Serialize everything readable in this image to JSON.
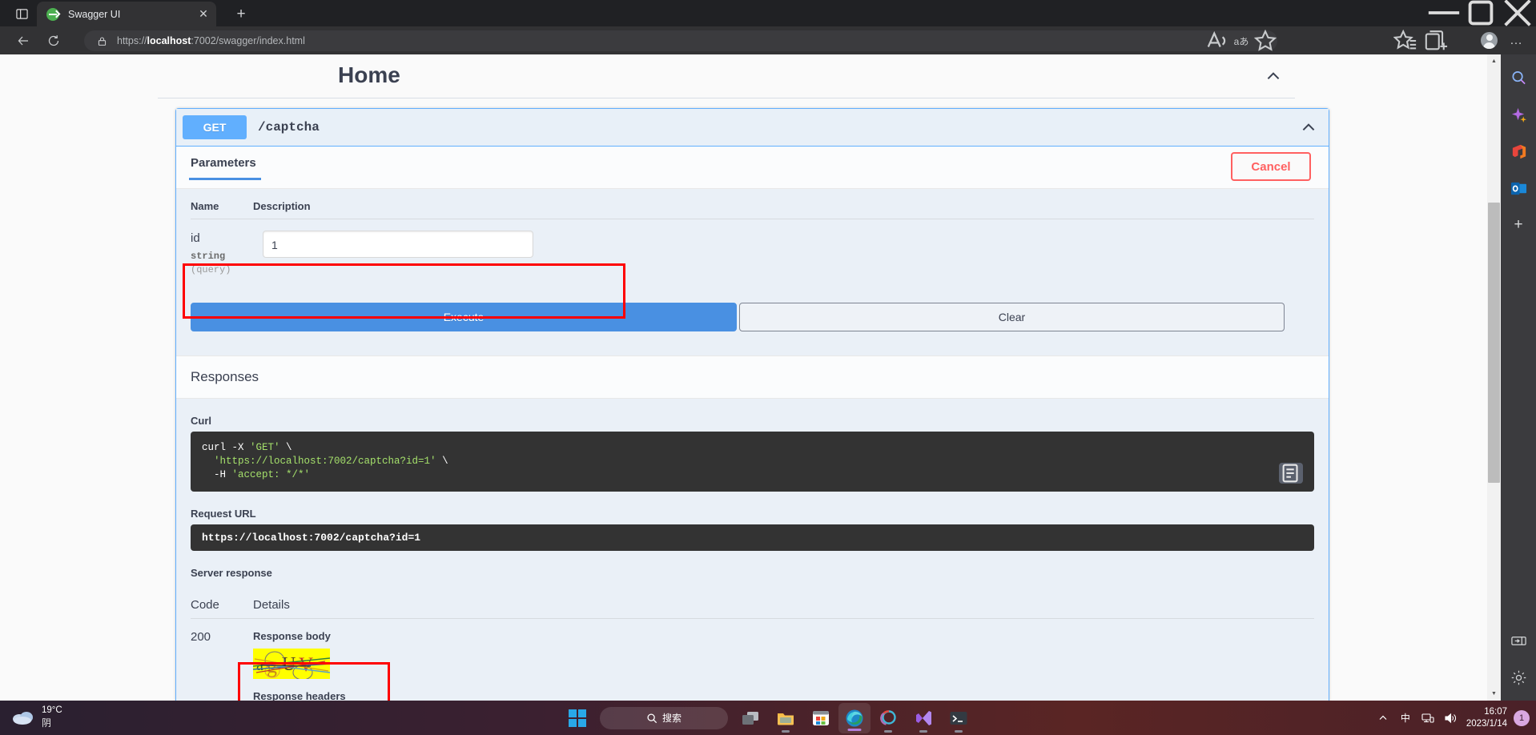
{
  "browser": {
    "tab_title": "Swagger UI",
    "tab_close": "✕",
    "new_tab": "+",
    "url_prefix": "https://",
    "url_host": "localhost",
    "url_rest": ":7002/swagger/index.html",
    "window_minimize": "—",
    "window_maximize": "❐",
    "window_close": "✕",
    "omni_more": "…",
    "read_aloud": "A",
    "translate": "aあ",
    "favorite": "☆"
  },
  "sidebar": {
    "items": [
      {
        "name": "search-icon"
      },
      {
        "name": "copilot-icon"
      },
      {
        "name": "office-icon"
      },
      {
        "name": "outlook-icon"
      },
      {
        "name": "add-icon",
        "label": "+"
      }
    ],
    "bottom": [
      {
        "name": "sidebar-toggle-icon"
      },
      {
        "name": "settings-gear-icon"
      }
    ]
  },
  "swagger": {
    "page_title": "Home",
    "operation": {
      "verb": "GET",
      "path": "/captcha"
    },
    "tab_parameters": "Parameters",
    "cancel_label": "Cancel",
    "param_headers": {
      "name": "Name",
      "description": "Description"
    },
    "parameter": {
      "name": "id",
      "type": "string",
      "location": "(query)",
      "value": "1",
      "placeholder": "id"
    },
    "execute_label": "Execute",
    "clear_label": "Clear",
    "responses_title": "Responses",
    "curl_label": "Curl",
    "curl_line1_cmd": "curl -X ",
    "curl_line1_val": "'GET'",
    "curl_line1_tail": " \\",
    "curl_line2": "  'https://localhost:7002/captcha?id=1'",
    "curl_line2_tail": " \\",
    "curl_line3_cmd": "  -H ",
    "curl_line3_val": "'accept: */*'",
    "request_url_label": "Request URL",
    "request_url": "https://localhost:7002/captcha?id=1",
    "server_response_label": "Server response",
    "code_header": "Code",
    "details_header": "Details",
    "response_code": "200",
    "response_body_label": "Response body",
    "response_headers_label": "Response headers",
    "captcha_text": "agUV",
    "captcha_bg": "#ffff00",
    "accent_blue": "#4990e2",
    "verb_blue": "#61affe",
    "cancel_red": "#ff6060",
    "annotation_red": "#ff0000"
  },
  "taskbar": {
    "weather_temp": "19°C",
    "weather_desc": "阴",
    "search_label": "搜索",
    "items": [
      {
        "name": "start-button"
      },
      {
        "name": "search-box"
      },
      {
        "name": "task-view-button"
      },
      {
        "name": "file-explorer-button"
      },
      {
        "name": "microsoft-store-button"
      },
      {
        "name": "edge-button"
      },
      {
        "name": "app-ring-button"
      },
      {
        "name": "visual-studio-button"
      },
      {
        "name": "terminal-button"
      }
    ],
    "tray_chevron": "︿",
    "ime": "中",
    "time": "16:07",
    "date": "2023/1/14",
    "notification_count": "1"
  }
}
